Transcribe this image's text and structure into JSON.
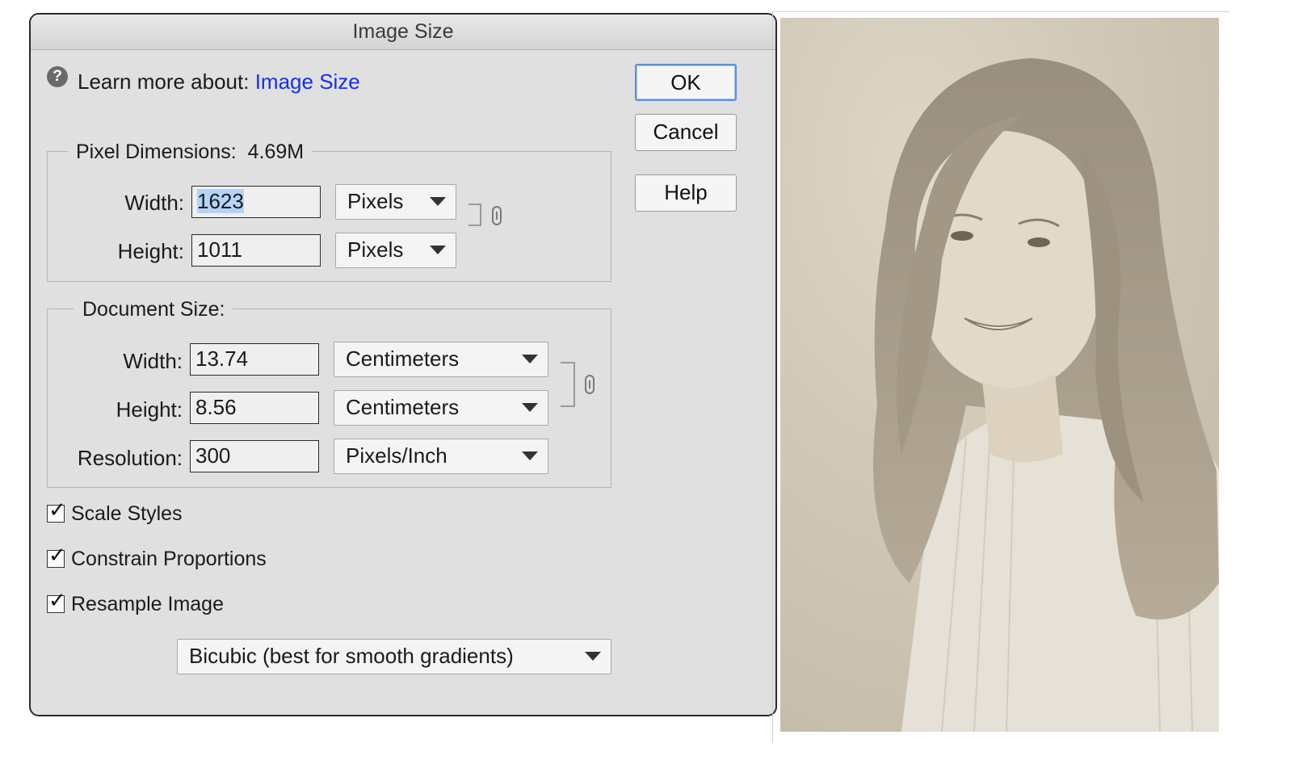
{
  "dialog": {
    "title": "Image Size",
    "help_prefix": "Learn more about:",
    "help_link": "Image Size",
    "buttons": {
      "ok": "OK",
      "cancel": "Cancel",
      "help": "Help"
    }
  },
  "pixel_dimensions": {
    "label": "Pixel Dimensions:",
    "size": "4.69M",
    "width_label": "Width:",
    "width_value": "1623",
    "width_unit": "Pixels",
    "height_label": "Height:",
    "height_value": "1011",
    "height_unit": "Pixels"
  },
  "document_size": {
    "label": "Document Size:",
    "width_label": "Width:",
    "width_value": "13.74",
    "width_unit": "Centimeters",
    "height_label": "Height:",
    "height_value": "8.56",
    "height_unit": "Centimeters",
    "resolution_label": "Resolution:",
    "resolution_value": "300",
    "resolution_unit": "Pixels/Inch"
  },
  "options": {
    "scale_styles": {
      "label": "Scale Styles",
      "checked": true
    },
    "constrain_proportions": {
      "label": "Constrain Proportions",
      "checked": true
    },
    "resample_image": {
      "label": "Resample Image",
      "checked": true
    }
  },
  "resample_method": "Bicubic (best for smooth gradients)",
  "colors": {
    "dialog_bg": "#e0e0e0",
    "link": "#1a2ee8",
    "selection": "#b4d3f7",
    "default_button_border": "#5b8fd8",
    "photo_sepia": "#cfc6b6"
  },
  "icons": {
    "help": "question-circle-icon",
    "link": "chain-link-icon",
    "check": "checkmark-icon",
    "dropdown": "chevron-down-icon"
  }
}
